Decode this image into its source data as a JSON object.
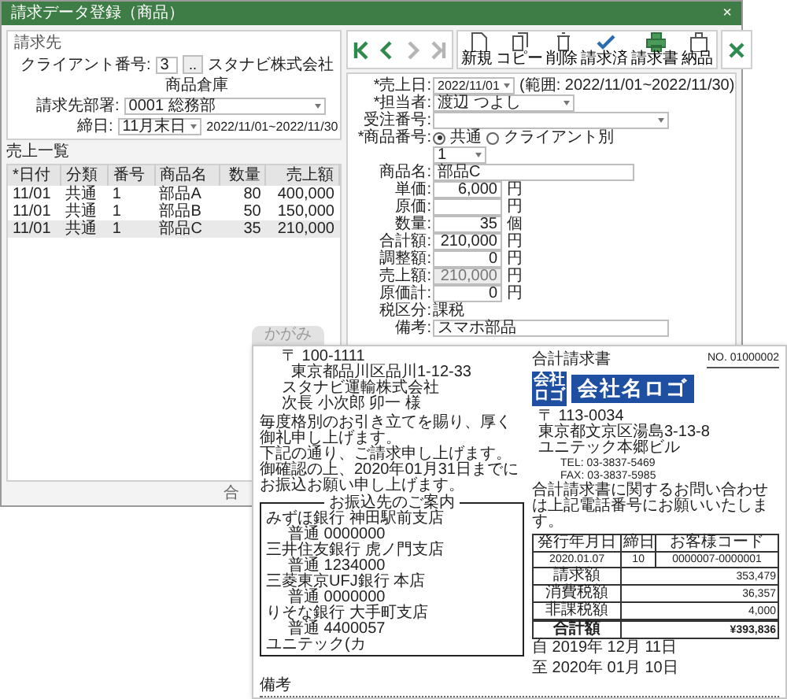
{
  "window": {
    "title": "請求データ登録（商品）",
    "close": "×"
  },
  "client": {
    "legend": "請求先",
    "client_no_label": "クライアント番号:",
    "client_no": "3",
    "lookup_button": "..",
    "client_name": "スタナビ株式会社",
    "warehouse": "商品倉庫",
    "dept_label": "請求先部署:",
    "dept": "0001 総務部",
    "closing_label": "締日:",
    "closing": "11月末日",
    "period": "2022/11/01~2022/11/30"
  },
  "sales_list": {
    "title": "売上一覧",
    "columns": [
      "*日付",
      "分類",
      "番号",
      "商品名",
      "数量",
      "売上額"
    ],
    "rows": [
      {
        "cells": [
          "11/01",
          "共通",
          "1",
          "部品A",
          "80",
          "400,000"
        ],
        "selected": false
      },
      {
        "cells": [
          "11/01",
          "共通",
          "1",
          "部品B",
          "50",
          "150,000"
        ],
        "selected": false
      },
      {
        "cells": [
          "11/01",
          "共通",
          "1",
          "部品C",
          "35",
          "210,000"
        ],
        "selected": true
      }
    ],
    "footer": "合"
  },
  "toolbar": {
    "nav": [
      {
        "kind": "first",
        "disabled": false
      },
      {
        "kind": "prev",
        "disabled": false
      },
      {
        "kind": "next",
        "disabled": true
      },
      {
        "kind": "last",
        "disabled": true
      }
    ],
    "buttons": [
      {
        "kind": "new",
        "label": "新規"
      },
      {
        "kind": "copy",
        "label": "コピー"
      },
      {
        "kind": "delete",
        "label": "削除"
      },
      {
        "kind": "done",
        "label": "請求済"
      },
      {
        "kind": "print",
        "label": "請求書"
      },
      {
        "kind": "delivery",
        "label": "納品"
      }
    ]
  },
  "form": [
    {
      "kind": "date",
      "label": "*売上日:",
      "value": "2022/11/01",
      "note": "(範囲: 2022/11/01~2022/11/30)"
    },
    {
      "kind": "select",
      "label": "*担当者:",
      "value": "渡辺 つよし"
    },
    {
      "kind": "wideselect",
      "label": "受注番号:"
    },
    {
      "kind": "radio",
      "label": "*商品番号:",
      "options": [
        {
          "label": "共通",
          "selected": true
        },
        {
          "label": "クライアント別",
          "selected": false
        }
      ],
      "select_value": "1"
    },
    {
      "kind": "text",
      "label": "商品名:",
      "value": "部品C"
    },
    {
      "kind": "amount",
      "label": "単価:",
      "value": "6,000",
      "unit": "円",
      "disabled": false
    },
    {
      "kind": "amount",
      "label": "原価:",
      "unit": "円",
      "disabled": false
    },
    {
      "kind": "amount",
      "label": "数量:",
      "value": "35",
      "unit": "個",
      "disabled": false
    },
    {
      "kind": "amount",
      "label": "合計額:",
      "value": "210,000",
      "unit": "円",
      "disabled": false
    },
    {
      "kind": "amount",
      "label": "調整額:",
      "value": "0",
      "unit": "円",
      "disabled": false
    },
    {
      "kind": "amount",
      "label": "売上額:",
      "value": "210,000",
      "unit": "円",
      "disabled": true
    },
    {
      "kind": "amount",
      "label": "原価計:",
      "value": "0",
      "unit": "円",
      "disabled": false
    },
    {
      "kind": "plain",
      "label": "税区分:",
      "value": "課税"
    },
    {
      "kind": "text",
      "label": "備考:",
      "value": "スマホ部品"
    }
  ],
  "invoice": {
    "tab": "かがみ",
    "recipient": [
      "〒 100-1111",
      "東京都品川区品川1-12-33",
      "スタナビ運輸株式会社",
      "次長 小次郎 卯一 様"
    ],
    "message": [
      "毎度格別のお引き立てを賜り、厚く御礼申し上げます。",
      "下記の通り、ご請求申し上げます。",
      "御確認の上、2020年01月31日までにお振込お願い申し上げます。"
    ],
    "bank": {
      "title": "お振込先のご案内",
      "lines": [
        "みずほ銀行 神田駅前支店",
        "普通 0000000",
        "三井住友銀行 虎ノ門支店",
        "普通 1234000",
        "三菱東京UFJ銀行 本店",
        "普通 0000000",
        "りそな銀行 大手町支店",
        "普通 4400057",
        "ユニテック(カ"
      ]
    },
    "remarks": "備考",
    "title": "合計請求書",
    "number": "NO. 01000002",
    "logo_mark": [
      "会社",
      "ロゴ"
    ],
    "logo_text": "会社名ロゴ",
    "sender": [
      "〒 113-0034",
      "東京都文京区湯島3-13-8",
      "ユニテック本郷ビル"
    ],
    "contact": [
      "TEL: 03-3837-5469",
      "FAX: 03-3837-5985"
    ],
    "inquiry": "合計請求書に関するお問い合わせは上記電話番号にお願いいたします。",
    "summary": {
      "head": [
        "発行年月日",
        "締日",
        "お客様コード"
      ],
      "values": [
        "2020.01.07",
        "10",
        "0000007-0000001"
      ],
      "rows": [
        {
          "label": "請求額",
          "value": "353,479",
          "total": false
        },
        {
          "label": "消費税額",
          "value": "36,357",
          "total": false
        },
        {
          "label": "非課税額",
          "value": "4,000",
          "total": false
        },
        {
          "label": "合計額",
          "value": "¥393,836",
          "total": true
        }
      ]
    },
    "period": [
      "自 2019年 12月 11日",
      "至 2020年 01月 10日"
    ]
  }
}
